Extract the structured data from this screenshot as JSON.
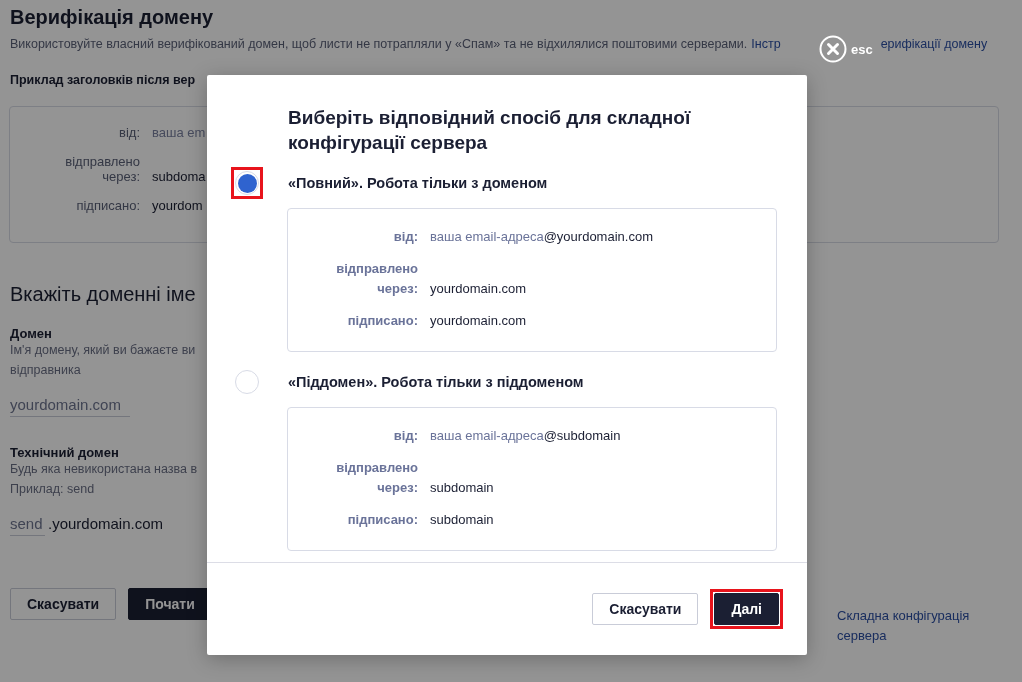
{
  "page": {
    "title": "Верифікація домену",
    "description": "Використовуйте власний верифікований домен, щоб листи не потрапляли у «Спам» та не відхилялися поштовими серверами.",
    "description_link_start": "Інстр",
    "description_link_end": "ерифікації домену",
    "example_heading": "Приклад заголовків після вер",
    "example_rows": [
      {
        "label": "від:",
        "value": "ваша em",
        "kind": "muted"
      },
      {
        "label": "відправлено через:",
        "value": "subdoma",
        "kind": "plain"
      },
      {
        "label": "підписано:",
        "value": "yourdom",
        "kind": "plain"
      }
    ],
    "domains_heading": "Вкажіть доменні іме",
    "domain": {
      "label": "Домен",
      "hint": "Ім'я домену, який ви бажаєте ви відправника",
      "placeholder": "yourdomain.com"
    },
    "tech_domain": {
      "label": "Технічний домен",
      "hint": "Будь яка невикористана назва в",
      "example": "Приклад: send",
      "placeholder": "send",
      "suffix": ".yourdomain.com"
    },
    "buttons": [
      {
        "label": "Скасувати",
        "kind": "secondary"
      },
      {
        "label": "Почати",
        "kind": "primary"
      }
    ],
    "side_link": "Складна конфігурація сервера"
  },
  "close": {
    "label": "esc"
  },
  "modal": {
    "title": "Виберіть відповідний спосіб для складної конфігурації сервера",
    "options": [
      {
        "label": "«Повний». Робота тільки з доменом",
        "selected": true,
        "highlighted": true,
        "rows": [
          {
            "label": "від:",
            "muted": "ваша email-адреса",
            "value": "@yourdomain.com"
          },
          {
            "label": "відправлено через:",
            "value": "yourdomain.com"
          },
          {
            "label": "підписано:",
            "value": "yourdomain.com"
          }
        ]
      },
      {
        "label": "«Піддомен». Робота тільки з піддоменом",
        "selected": false,
        "highlighted": false,
        "rows": [
          {
            "label": "від:",
            "muted": "ваша email-адреса",
            "value": "@subdomain"
          },
          {
            "label": "відправлено через:",
            "value": "subdomain"
          },
          {
            "label": "підписано:",
            "value": "subdomain"
          }
        ]
      }
    ],
    "buttons": [
      {
        "label": "Скасувати",
        "kind": "secondary",
        "highlighted": false
      },
      {
        "label": "Далі",
        "kind": "primary",
        "highlighted": true
      }
    ]
  }
}
